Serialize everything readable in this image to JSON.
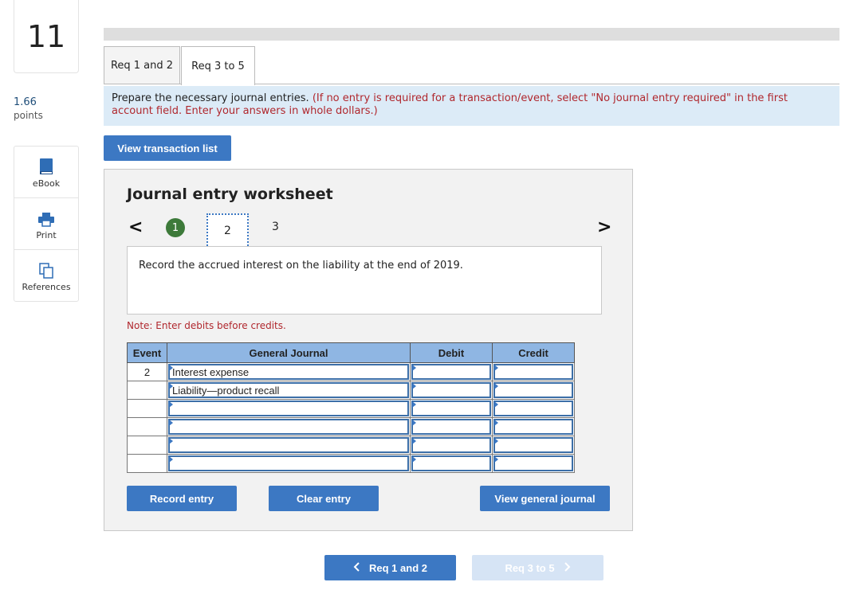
{
  "question": {
    "number": "11",
    "points_value": "1.66",
    "points_label": "points"
  },
  "tools": [
    {
      "label": "eBook",
      "icon": "book-icon"
    },
    {
      "label": "Print",
      "icon": "printer-icon"
    },
    {
      "label": "References",
      "icon": "copy-icon"
    }
  ],
  "tabs": [
    {
      "label": "Req 1 and 2",
      "active": false
    },
    {
      "label": "Req 3 to 5",
      "active": true
    }
  ],
  "instructions": {
    "main": "Prepare the necessary journal entries.",
    "red": "(If no entry is required for a transaction/event, select \"No journal entry required\" in the first account field. Enter your answers in whole dollars.)"
  },
  "view_transaction_list": "View transaction list",
  "worksheet": {
    "title": "Journal entry worksheet",
    "prev": "<",
    "next": ">",
    "steps": [
      "1",
      "2",
      "3"
    ],
    "current_step": "2",
    "description": "Record the accrued interest on the liability at the end of 2019.",
    "note": "Note: Enter debits before credits.",
    "columns": [
      "Event",
      "General Journal",
      "Debit",
      "Credit"
    ],
    "rows": [
      {
        "event": "2",
        "account": "Interest expense",
        "debit": "",
        "credit": ""
      },
      {
        "event": "",
        "account": "Liability—product recall",
        "debit": "",
        "credit": ""
      },
      {
        "event": "",
        "account": "",
        "debit": "",
        "credit": ""
      },
      {
        "event": "",
        "account": "",
        "debit": "",
        "credit": ""
      },
      {
        "event": "",
        "account": "",
        "debit": "",
        "credit": ""
      },
      {
        "event": "",
        "account": "",
        "debit": "",
        "credit": ""
      }
    ],
    "buttons": {
      "record": "Record entry",
      "clear": "Clear entry",
      "view_journal": "View general journal"
    }
  },
  "pager": {
    "prev_label": "Req 1 and 2",
    "prev_icon": "chevron-left-icon",
    "next_label": "Req 3 to 5",
    "next_icon": "chevron-right-icon",
    "next_disabled": true
  },
  "colors": {
    "accent": "#3c78c3",
    "header": "#8fb6e3",
    "red": "#b0272d",
    "success": "#3d7a3a"
  }
}
